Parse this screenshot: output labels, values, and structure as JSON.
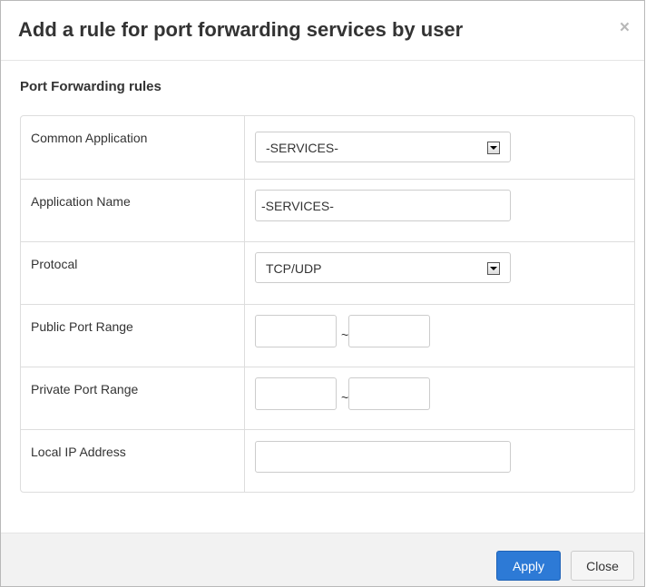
{
  "dialog": {
    "title": "Add a rule for port forwarding services by user",
    "close_glyph": "×"
  },
  "section": {
    "title": "Port Forwarding rules"
  },
  "rows": {
    "common_application": {
      "label": "Common Application",
      "value": "-SERVICES-"
    },
    "application_name": {
      "label": "Application Name",
      "value": "-SERVICES-"
    },
    "protocol": {
      "label": "Protocal",
      "value": "TCP/UDP"
    },
    "public_port_range": {
      "label": "Public Port Range",
      "separator": "~",
      "start": "",
      "end": ""
    },
    "private_port_range": {
      "label": "Private Port Range",
      "separator": "~",
      "start": "",
      "end": ""
    },
    "local_ip": {
      "label": "Local IP Address",
      "value": ""
    }
  },
  "footer": {
    "apply_label": "Apply",
    "close_label": "Close"
  },
  "colors": {
    "primary_button": "#2d7ad6",
    "border": "#dddddd",
    "footer_bg": "#f2f2f2"
  }
}
